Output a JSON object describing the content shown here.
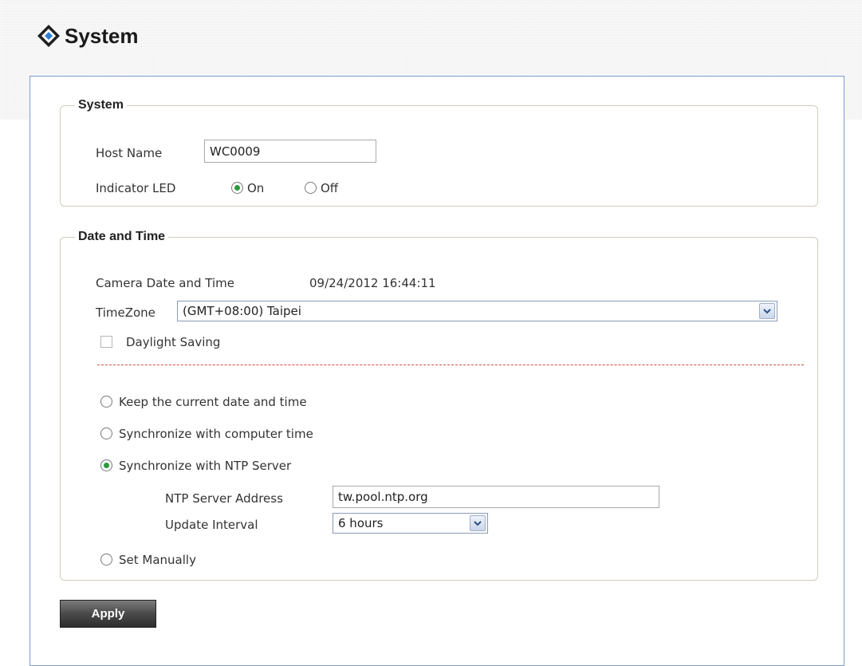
{
  "header": {
    "title": "System",
    "icon": "system-logo-icon"
  },
  "system_section": {
    "legend": "System",
    "host_name_label": "Host Name",
    "host_name_value": "WC0009",
    "indicator_led_label": "Indicator LED",
    "led_on_label": "On",
    "led_off_label": "Off",
    "led_selected": "On"
  },
  "datetime_section": {
    "legend": "Date and Time",
    "camera_datetime_label": "Camera Date and Time",
    "camera_datetime_value": "09/24/2012 16:44:11",
    "timezone_label": "TimeZone",
    "timezone_value": "(GMT+08:00) Taipei",
    "daylight_saving_label": "Daylight Saving",
    "daylight_saving_checked": false,
    "options": {
      "keep_current": "Keep the current date and time",
      "sync_computer": "Synchronize with computer time",
      "sync_ntp": "Synchronize with NTP Server",
      "set_manually": "Set Manually"
    },
    "selected_option": "Synchronize with NTP Server",
    "ntp_server_address_label": "NTP Server Address",
    "ntp_server_address_value": "tw.pool.ntp.org",
    "update_interval_label": "Update Interval",
    "update_interval_value": "6 hours"
  },
  "apply_label": "Apply",
  "colors": {
    "panel_border": "#7f9cc9",
    "fieldset_border": "#d3ccbd",
    "radio_selected": "#2c9a3b",
    "divider": "#d84a4a",
    "button_dark": "#2d2d2d"
  }
}
